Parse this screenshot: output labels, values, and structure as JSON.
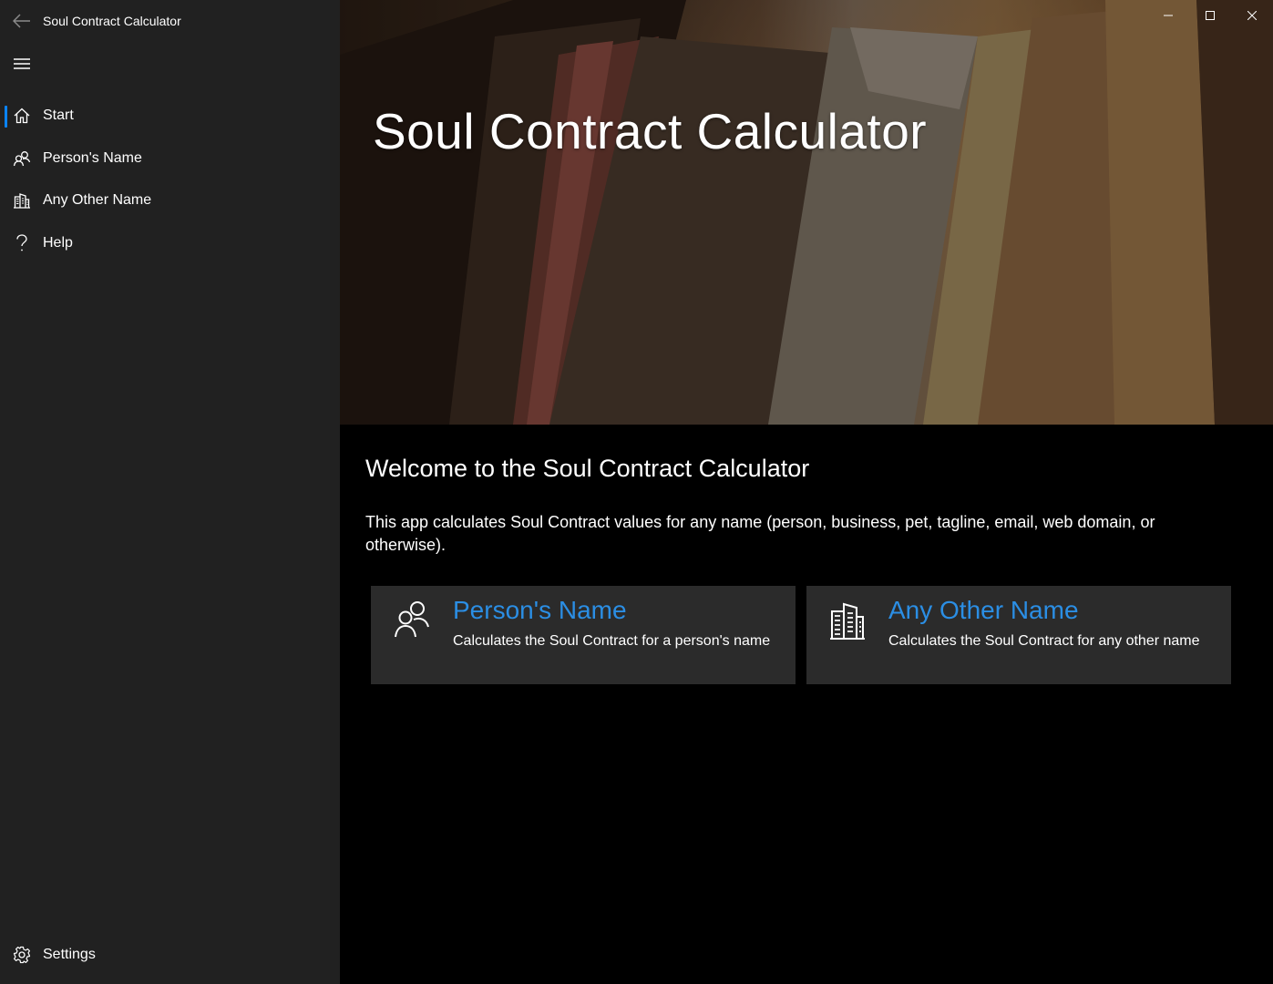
{
  "window": {
    "app_title": "Soul Contract Calculator"
  },
  "sidebar": {
    "items": [
      {
        "label": "Start",
        "icon": "home-icon",
        "selected": true
      },
      {
        "label": "Person's Name",
        "icon": "people-icon",
        "selected": false
      },
      {
        "label": "Any Other Name",
        "icon": "building-icon",
        "selected": false
      },
      {
        "label": "Help",
        "icon": "question-icon",
        "selected": false
      }
    ],
    "settings_label": "Settings"
  },
  "hero": {
    "title": "Soul Contract Calculator"
  },
  "main": {
    "welcome": "Welcome to the Soul Contract Calculator",
    "description": "This app calculates Soul Contract values for any name (person, business, pet, tagline, email, web domain, or otherwise).",
    "cards": [
      {
        "title": "Person's Name",
        "description": "Calculates the Soul Contract for a person's name",
        "icon": "people-icon"
      },
      {
        "title": "Any Other Name",
        "description": "Calculates the Soul Contract for any other name",
        "icon": "building-icon"
      }
    ]
  },
  "colors": {
    "accent": "#0a84ff",
    "link": "#2b8ee4",
    "sidebar_bg": "#212121",
    "card_bg": "#2b2b2b"
  }
}
